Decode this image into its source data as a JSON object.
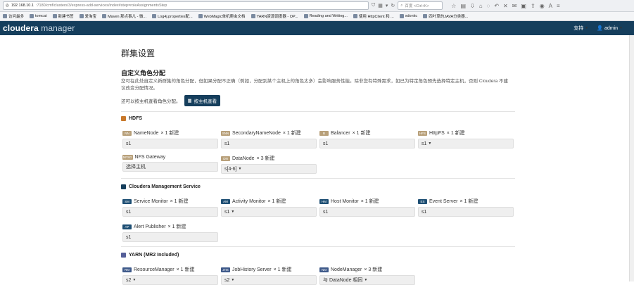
{
  "browser": {
    "url_host": "192.168.10.1",
    "url_path": ":7180/cmf/clusters/3/express-add-services/index#step=roleAssignmentsStep",
    "search_placeholder": "百度 <Ctrl+K>",
    "bookmarks": [
      "访问最多",
      "tomcat",
      "新建书签",
      "爱淘宝",
      "Maven 那点事儿 - 微...",
      "Log4j.properties配...",
      "WebMagic单机爬虫文档",
      "YARN资源调度器 - OP...",
      "Reading and Writing...",
      "使用 HttpClient 和 ...",
      "xdonkc",
      "四叶草的JAVA分类器..."
    ]
  },
  "app": {
    "logo_main": "cloudera",
    "logo_sub": "manager",
    "support_label": "支持",
    "user_label": "admin"
  },
  "page": {
    "title": "群集设置",
    "section_title": "自定义角色分配",
    "description": "您可在此处自定义新群集的角色分配，但如果分配不正确（例如，分配到某个主机上的角色太多）会影响服务性能。除非您有特殊需求，如已为特定角色预先选择特定主机，否则 Cloudera 不建议改变分配情况。",
    "host_hint": "还可以按主机查看角色分配。",
    "host_button": "按主机查看"
  },
  "services": [
    {
      "name": "HDFS",
      "icon_color": "#c8782a",
      "roles": [
        {
          "tag": "NN",
          "tag_color": "#b8a07a",
          "name": "NameNode",
          "count": "× 1 新建",
          "value": "s1",
          "dropdown": false
        },
        {
          "tag": "SNN",
          "tag_color": "#b8a07a",
          "name": "SecondaryNameNode",
          "count": "× 1 新建",
          "value": "s1",
          "dropdown": false
        },
        {
          "tag": "B",
          "tag_color": "#b8a07a",
          "name": "Balancer",
          "count": "× 1 新建",
          "value": "s1",
          "dropdown": false
        },
        {
          "tag": "HFS",
          "tag_color": "#b8a07a",
          "name": "HttpFS",
          "count": "× 1 新建",
          "value": "s1",
          "dropdown": true
        },
        {
          "tag": "NFSG",
          "tag_color": "#b8a07a",
          "name": "NFS Gateway",
          "count": "",
          "value": "选择主机",
          "dropdown": false
        },
        {
          "tag": "DN",
          "tag_color": "#b8a07a",
          "name": "DataNode",
          "count": "× 3 新建",
          "value": "s[4-6]",
          "dropdown": true
        }
      ]
    },
    {
      "name": "Cloudera Management Service",
      "icon_color": "#153e5c",
      "roles": [
        {
          "tag": "SM",
          "tag_color": "#1e4f74",
          "name": "Service Monitor",
          "count": "× 1 新建",
          "value": "s1",
          "dropdown": false
        },
        {
          "tag": "AM",
          "tag_color": "#1e4f74",
          "name": "Activity Monitor",
          "count": "× 1 新建",
          "value": "s1",
          "dropdown": true
        },
        {
          "tag": "HM",
          "tag_color": "#1e4f74",
          "name": "Host Monitor",
          "count": "× 1 新建",
          "value": "s1",
          "dropdown": false
        },
        {
          "tag": "ES",
          "tag_color": "#1e4f74",
          "name": "Event Server",
          "count": "× 1 新建",
          "value": "s1",
          "dropdown": false
        },
        {
          "tag": "AP",
          "tag_color": "#1e4f74",
          "name": "Alert Publisher",
          "count": "× 1 新建",
          "value": "s1",
          "dropdown": false
        }
      ]
    },
    {
      "name": "YARN (MR2 Included)",
      "icon_color": "#555f99",
      "roles": [
        {
          "tag": "RM",
          "tag_color": "#3f5a8a",
          "name": "ResourceManager",
          "count": "× 1 新建",
          "value": "s2",
          "dropdown": true
        },
        {
          "tag": "JHS",
          "tag_color": "#3f5a8a",
          "name": "JobHistory Server",
          "count": "× 1 新建",
          "value": "s2",
          "dropdown": true
        },
        {
          "tag": "NM",
          "tag_color": "#3f5a8a",
          "name": "NodeManager",
          "count": "× 3 新建",
          "value": "与 DataNode 相同",
          "dropdown": true
        }
      ]
    }
  ],
  "icons": {
    "back": "arrow-left-icon",
    "home": "home-icon",
    "user": "user-icon",
    "grid": "grid-icon"
  }
}
